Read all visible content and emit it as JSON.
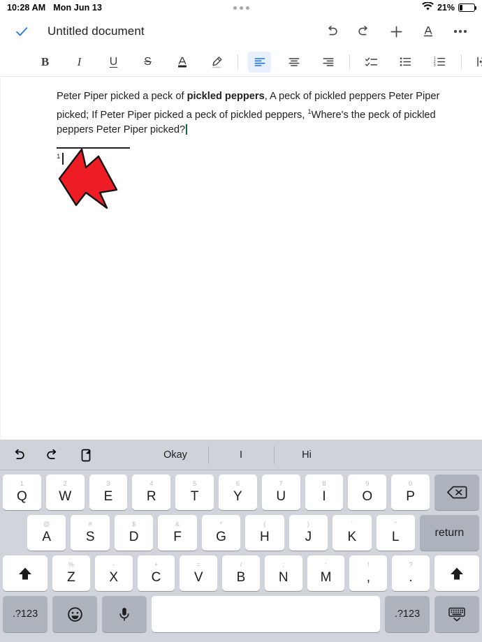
{
  "status_bar": {
    "time": "10:28 AM",
    "date": "Mon Jun 13",
    "battery_percent": "21%",
    "wifi_icon": "wifi-icon",
    "battery_icon": "battery-icon",
    "handle_icon": "multitask-handle-icon"
  },
  "doc_header": {
    "check_icon": "checkmark-icon",
    "title": "Untitled document",
    "actions": [
      {
        "name": "undo-button",
        "icon": "undo-icon"
      },
      {
        "name": "redo-button",
        "icon": "redo-icon"
      },
      {
        "name": "insert-button",
        "icon": "plus-icon"
      },
      {
        "name": "format-button",
        "icon": "text-format-icon"
      },
      {
        "name": "more-options-button",
        "icon": "more-vertical-icon"
      }
    ]
  },
  "format_toolbar": {
    "items": [
      {
        "name": "bold-button",
        "label": "B",
        "icon": "bold-icon",
        "active": false
      },
      {
        "name": "italic-button",
        "label": "I",
        "icon": "italic-icon",
        "active": false
      },
      {
        "name": "underline-button",
        "label": "U",
        "icon": "underline-icon",
        "active": false
      },
      {
        "name": "strikethrough-button",
        "label": "S",
        "icon": "strikethrough-icon",
        "active": false
      },
      {
        "name": "text-color-button",
        "label": "A",
        "icon": "text-color-icon",
        "active": false
      },
      {
        "name": "highlight-button",
        "label": "",
        "icon": "highlighter-pen-icon",
        "active": false
      },
      {
        "name": "align-left-button",
        "label": "",
        "icon": "align-left-icon",
        "active": true
      },
      {
        "name": "align-center-button",
        "label": "",
        "icon": "align-center-icon",
        "active": false
      },
      {
        "name": "align-right-button",
        "label": "",
        "icon": "align-right-icon",
        "active": false
      },
      {
        "name": "checklist-button",
        "label": "",
        "icon": "checklist-icon",
        "active": false
      },
      {
        "name": "bulleted-list-button",
        "label": "",
        "icon": "bulleted-list-icon",
        "active": false
      },
      {
        "name": "numbered-list-button",
        "label": "",
        "icon": "numbered-list-icon",
        "active": false
      },
      {
        "name": "decrease-indent-button",
        "label": "",
        "icon": "decrease-indent-icon",
        "active": false
      },
      {
        "name": "increase-indent-button",
        "label": "",
        "icon": "increase-indent-icon",
        "active": false
      }
    ]
  },
  "document": {
    "paragraph": {
      "part1": "Peter Piper picked a peck of ",
      "bold": "pickled peppers",
      "part2": ", A peck of pickled peppers Peter Piper picked; If Peter Piper picked a peck of pickled peppers, ",
      "footnote_marker": "1",
      "part3": "Where's the peck of pickled peppers Peter Piper picked?"
    },
    "footnote": {
      "number": "1",
      "text": ""
    },
    "annotation_icon": "red-arrow-annotation"
  },
  "keyboard": {
    "suggestion_bar": {
      "icons": [
        {
          "name": "keyboard-undo-button",
          "icon": "undo-icon"
        },
        {
          "name": "keyboard-redo-button",
          "icon": "redo-icon"
        },
        {
          "name": "keyboard-paste-button",
          "icon": "clipboard-paste-icon"
        }
      ],
      "suggestions": [
        "Okay",
        "I",
        "Hi"
      ]
    },
    "row1": [
      {
        "pri": "Q",
        "sec": "1"
      },
      {
        "pri": "W",
        "sec": "2"
      },
      {
        "pri": "E",
        "sec": "3"
      },
      {
        "pri": "R",
        "sec": "4"
      },
      {
        "pri": "T",
        "sec": "5"
      },
      {
        "pri": "Y",
        "sec": "6"
      },
      {
        "pri": "U",
        "sec": "7"
      },
      {
        "pri": "I",
        "sec": "8"
      },
      {
        "pri": "O",
        "sec": "9"
      },
      {
        "pri": "P",
        "sec": "0"
      }
    ],
    "backspace_icon": "backspace-icon",
    "row2": [
      {
        "pri": "A",
        "sec": "@"
      },
      {
        "pri": "S",
        "sec": "#"
      },
      {
        "pri": "D",
        "sec": "$"
      },
      {
        "pri": "F",
        "sec": "&"
      },
      {
        "pri": "G",
        "sec": "*"
      },
      {
        "pri": "H",
        "sec": "("
      },
      {
        "pri": "J",
        "sec": ")"
      },
      {
        "pri": "K",
        "sec": "'"
      },
      {
        "pri": "L",
        "sec": "\""
      }
    ],
    "return_label": "return",
    "row3": [
      {
        "pri": "Z",
        "sec": "%"
      },
      {
        "pri": "X",
        "sec": "-"
      },
      {
        "pri": "C",
        "sec": "+"
      },
      {
        "pri": "V",
        "sec": "="
      },
      {
        "pri": "B",
        "sec": "/"
      },
      {
        "pri": "N",
        "sec": ";"
      },
      {
        "pri": "M",
        "sec": ":"
      },
      {
        "pri": ",",
        "sec": "!"
      },
      {
        "pri": ".",
        "sec": "?"
      }
    ],
    "shift_left_icon": "shift-icon",
    "shift_right_icon": "shift-icon",
    "row4": {
      "numbers_left": ".?123",
      "emoji_icon": "emoji-smiley-icon",
      "mic_icon": "microphone-icon",
      "space_label": "",
      "numbers_right": ".?123",
      "hide_keyboard_icon": "hide-keyboard-icon"
    }
  },
  "colors": {
    "accent": "#1a73e8",
    "toolbar_active_bg": "#e8f0fe",
    "keyboard_bg": "#d1d4da",
    "key_bg": "#ffffff",
    "dark_key_bg": "#adb3bd",
    "arrow_red": "#ee1c25",
    "text": "#202124"
  }
}
